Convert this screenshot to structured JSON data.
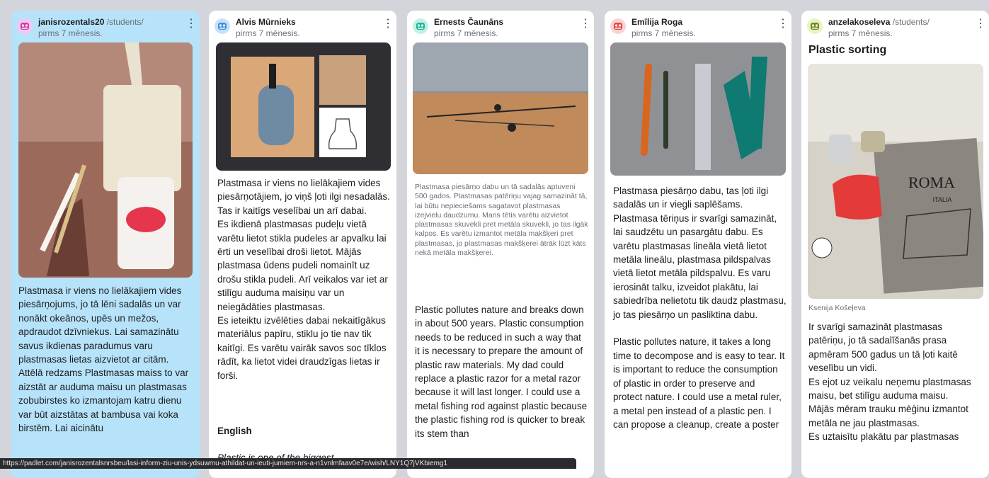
{
  "posts": [
    {
      "author": "janisrozentals20",
      "author_path": " /students/",
      "time": "pirms 7 mēnesis.",
      "body": "Plastmasa ir viens no lielākajiem vides piesārņojums, jo tā lēni sadalās un var nonākt okeānos, upēs un mežos, apdraudot dzīvniekus. Lai samazinātu savus ikdienas paradumus varu plastmasas lietas aizvietot ar citām. Attēlā redzams Plastmasas maiss to var aizstāt ar auduma maisu un plastmasas zobubirstes ko izmantojam katru dienu var būt aizstātas at bambusa vai koka birstēm. Lai aicinātu"
    },
    {
      "author": "Alvis Mūrnieks",
      "author_path": "",
      "time": "pirms 7 mēnesis.",
      "body": "Plastmasa ir viens no lielākajiem vides piesārņotājiem, jo viņš ļoti ilgi nesadalās. Tas ir kaitīgs veselībai un arī dabai.\nEs ikdienā plastmasas pudeļu vietā varētu lietot stikla pudeles ar apvalku lai ērti un veselībai droši lietot. Mājās plastmasa ūdens pudeli nomainīt uz drošu stikla pudeli. Arī veikalos var iet ar stilīgu auduma maisiņu var un neiegādāties plastmasas.\nEs ieteiktu izvēlēties dabai nekaitīgākus materiālus papīru, stiklu jo tie nav tik kaitīgi. Es varētu vairāk savos soc tīklos rādīt, ka lietot videi draudzīgas lietas ir forši.",
      "heading": "English",
      "body2": "Plastic is one of the biggest"
    },
    {
      "author": "Ernests Čaunāns",
      "author_path": "",
      "time": "pirms 7 mēnesis.",
      "small": "Plastmasa piesārņo dabu un tā sadalās aptuveni 500 gados. Plastmasas patēriņu vajag samazināt tā, lai būtu nepieciešams sagatavot plastmasas izejvielu daudzumu. Mans tētis varētu aizvietot plastmasas skuvekli pret metāla skuvekli, jo tas ilgāk kalpos. Es varētu izmantot metāla makšķeri pret plastmasas, jo plastmasas makšķerei ātrāk lūzt kāts nekā metāla makšķerei.",
      "body": "Plastic pollutes nature and breaks down in about 500 years. Plastic consumption needs to be reduced in such a way that it is necessary to prepare the amount of plastic raw materials. My dad could replace a plastic razor for a metal razor because it will last longer. I could use a metal fishing rod against plastic because the plastic fishing rod is quicker to break its stem than"
    },
    {
      "author": "Emīlija Roga",
      "author_path": "",
      "time": "pirms 7 mēnesis.",
      "body": "Plastmasa piesārņo dabu, tas ļoti ilgi sadalās un ir viegli saplēšams. Plastmasa tēriņus ir svarīgi samazināt, lai saudzētu un pasargātu dabu. Es varētu plastmasas lineāla vietā lietot metāla lineālu, plastmasa pildspalvas vietā lietot metāla pildspalvu. Es varu ierosināt talku, izveidot plakātu, lai sabiedrība nelietotu tik daudz plastmasu, jo tas piesārņo un pasliktina dabu.\n\nPlastic pollutes nature, it takes a long time to decompose and is easy to tear. It is important to reduce the consumption of plastic in order to preserve and protect nature. I could use a metal ruler, a metal pen instead of a plastic pen. I can propose a cleanup, create a poster"
    },
    {
      "author": "anzelakoseleva",
      "author_path": " /students/",
      "time": "pirms 7 mēnesis.",
      "title": "Plastic sorting",
      "caption": "Ksenija Košeļeva",
      "body": "Ir svarīgi samazināt plastmasas patēriņu, jo tā sadalīšanās prasa apmēram 500 gadus un tā ļoti kaitē veselību un vidi.\nEs ejot uz veikalu neņemu plastmasas maisu, bet stilīgu auduma maisu.\nMājās mēram trauku mēģinu izmantot metāla ne jau plastmasas.\nEs uztaisītu plakātu par plastmasas",
      "poster_text": "ROMA",
      "poster_sub": "ITALIA"
    }
  ],
  "statusbar": "https://padlet.com/janisrozentalsnrsbeu/lasi-inform-ziu-unis-ydsuwmu-athildat-un-ieuti-jumiem-nrs-a-n1vnlmfaav0e7e/wish/LNY1Q7jVKbiemg1"
}
